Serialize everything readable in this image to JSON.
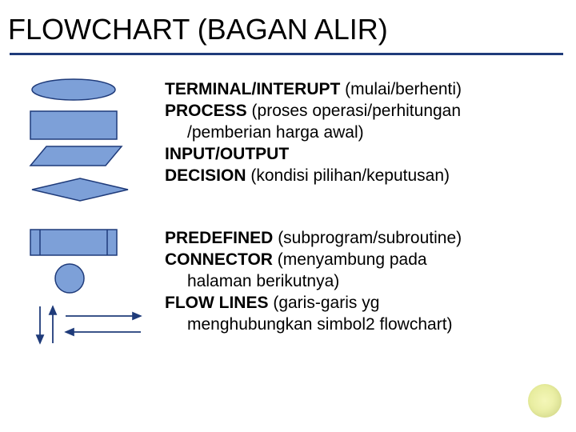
{
  "title": "FLOWCHART (BAGAN ALIR)",
  "group1": {
    "terminal_label": "TERMINAL/INTERUPT",
    "terminal_desc": " (mulai/berhenti)",
    "process_label": "PROCESS",
    "process_desc": " (proses operasi/perhitungan",
    "process_desc2": "/pemberian harga awal)",
    "io_label": "INPUT/OUTPUT",
    "decision_label": "DECISION",
    "decision_desc": " (kondisi pilihan/keputusan)"
  },
  "group2": {
    "predefined_label": "PREDEFINED",
    "predefined_desc": " (subprogram/subroutine)",
    "connector_label": "CONNECTOR",
    "connector_desc": " (menyambung pada",
    "connector_desc2": "halaman berikutnya)",
    "flowlines_label": "FLOW LINES",
    "flowlines_desc": " (garis-garis yg",
    "flowlines_desc2": "menghubungkan simbol2 flowchart)"
  }
}
